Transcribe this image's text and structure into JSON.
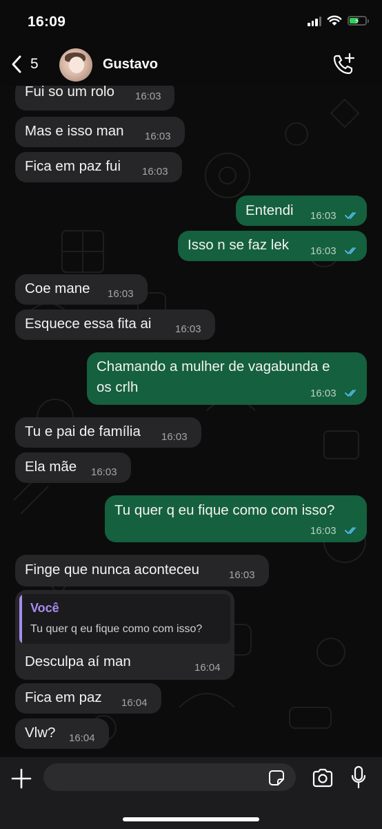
{
  "status_bar": {
    "time": "16:09"
  },
  "header": {
    "back_count": "5",
    "contact_name": "Gustavo"
  },
  "messages": [
    {
      "dir": "in",
      "text": "Fui so um rolo",
      "time": "16:03"
    },
    {
      "dir": "in",
      "text": "Mas e isso man",
      "time": "16:03"
    },
    {
      "dir": "in",
      "text": "Fica em paz fui",
      "time": "16:03"
    },
    {
      "dir": "out",
      "text": "Entendi",
      "time": "16:03"
    },
    {
      "dir": "out",
      "text": "Isso n se faz lek",
      "time": "16:03"
    },
    {
      "dir": "in",
      "text": "Coe mane",
      "time": "16:03"
    },
    {
      "dir": "in",
      "text": "Esquece essa fita ai",
      "time": "16:03"
    },
    {
      "dir": "out",
      "text_line1": "Chamando a mulher de vagabunda e",
      "text_line2": "os crlh",
      "time": "16:03"
    },
    {
      "dir": "in",
      "text": "Tu e pai de família",
      "time": "16:03"
    },
    {
      "dir": "in",
      "text": "Ela mãe",
      "time": "16:03"
    },
    {
      "dir": "out",
      "text": "Tu quer q eu fique como com isso?",
      "time": "16:03"
    },
    {
      "dir": "in",
      "text": "Finge que nunca aconteceu",
      "time": "16:03"
    },
    {
      "dir": "in",
      "quote_author": "Você",
      "quote_text": "Tu quer q eu fique como com isso?",
      "text": "Desculpa aí man",
      "time": "16:04"
    },
    {
      "dir": "in",
      "text": "Fica em paz",
      "time": "16:04"
    },
    {
      "dir": "in",
      "text": "Vlw?",
      "time": "16:04"
    }
  ],
  "colors": {
    "incoming_bubble": "#262628",
    "outgoing_bubble": "#15603e",
    "read_ticks": "#53bdeb",
    "quote_accent": "#a98cf0",
    "battery_charging": "#30d158"
  },
  "icons": {
    "back": "chevron-left-icon",
    "call": "phone-plus-icon",
    "attach": "plus-icon",
    "sticker": "sticker-icon",
    "camera": "camera-icon",
    "mic": "microphone-icon",
    "read_receipt": "double-check-icon"
  }
}
